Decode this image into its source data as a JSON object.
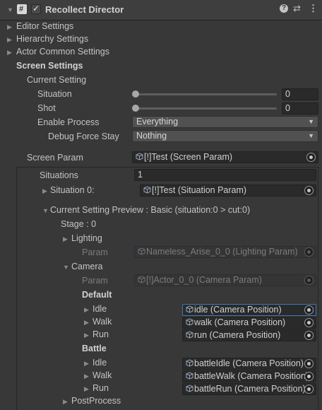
{
  "header": {
    "component_icon": "script-icon",
    "title": "Recollect Director",
    "enabled": true,
    "icons": [
      "help-icon",
      "presets-icon",
      "more-icon"
    ]
  },
  "sections": {
    "editor_settings": "Editor Settings",
    "hierarchy_settings": "Hierarchy Settings",
    "actor_common_settings": "Actor Common Settings",
    "screen_settings": "Screen Settings"
  },
  "current_setting": {
    "label": "Current Setting",
    "situation_label": "Situation",
    "situation_value": "0",
    "shot_label": "Shot",
    "shot_value": "0",
    "enable_process_label": "Enable Process",
    "enable_process_value": "Everything",
    "debug_force_stay_label": "Debug Force Stay",
    "debug_force_stay_value": "Nothing"
  },
  "screen_param": {
    "label": "Screen Param",
    "value": "[!]Test (Screen Param)"
  },
  "situations": {
    "label": "Situations",
    "count": "1",
    "item0_label": "Situation 0:",
    "item0_value": "[!]Test (Situation Param)"
  },
  "preview": {
    "label": "Current Setting Preview : Basic (situation:0 > cut:0)",
    "stage": "Stage : 0",
    "lighting": "Lighting",
    "lighting_param_label": "Param",
    "lighting_param_value": "Nameless_Arise_0_0 (Lighting Param)",
    "camera": "Camera",
    "camera_param_label": "Param",
    "camera_param_value": "[!]Actor_0_0 (Camera Param)",
    "default_label": "Default",
    "default_items": [
      {
        "label": "Idle",
        "value": "idle (Camera Position)"
      },
      {
        "label": "Walk",
        "value": "walk (Camera Position)"
      },
      {
        "label": "Run",
        "value": "run (Camera Position)"
      }
    ],
    "battle_label": "Battle",
    "battle_items": [
      {
        "label": "Idle",
        "value": "battleIdle (Camera Position)"
      },
      {
        "label": "Walk",
        "value": "battleWalk (Camera Position)"
      },
      {
        "label": "Run",
        "value": "battleRun (Camera Position)"
      }
    ],
    "postprocess": "PostProcess"
  }
}
